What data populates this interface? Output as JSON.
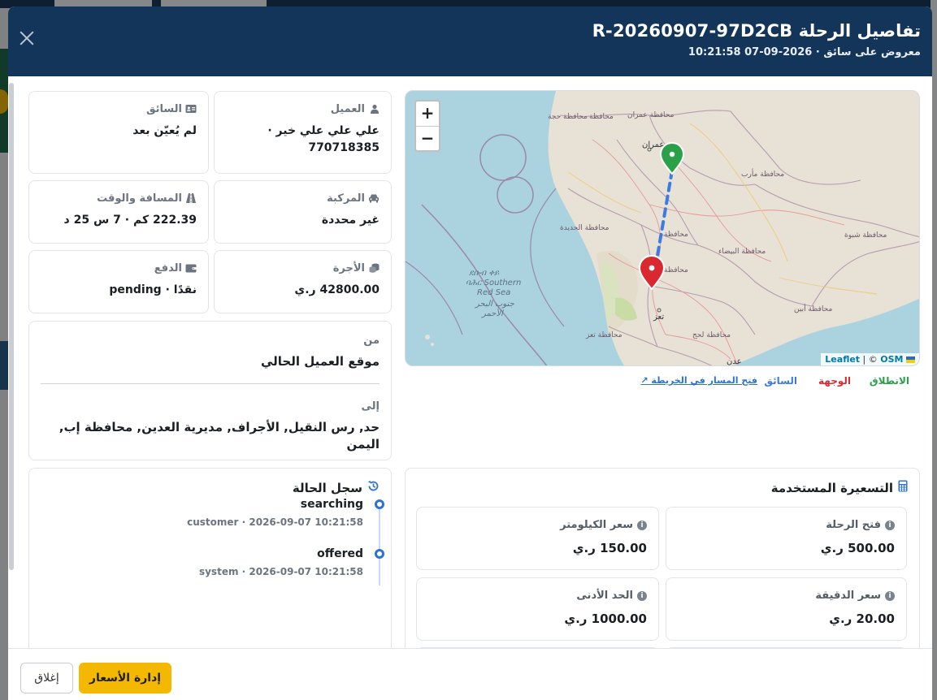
{
  "modal": {
    "title": "تفاصيل الرحلة R-20260907-97D2CB",
    "subtitle": "معروض على سائق · 2026-09-07 10:21:58"
  },
  "customer": {
    "label": "العميل",
    "value": "علي علي علي خير · 770718385",
    "icon": "user-icon"
  },
  "driver": {
    "label": "السائق",
    "value": "لم يُعيّن بعد",
    "icon": "id-card-icon"
  },
  "vehicle": {
    "label": "المركبة",
    "value": "غير محددة",
    "icon": "car-icon"
  },
  "distance": {
    "label": "المسافة والوقت",
    "value": "222.39 كم · 7 س 25 د",
    "icon": "road-icon"
  },
  "fare": {
    "label": "الأجرة",
    "value": "42800.00 ر.ي",
    "icon": "coins-icon"
  },
  "payment": {
    "label": "الدفع",
    "value": "نقدًا · pending",
    "icon": "wallet-icon"
  },
  "route": {
    "from_label": "من",
    "from_value": "موقع العميل الحالي",
    "to_label": "إلى",
    "to_value": "حد, رس النقيل, الأجراف, مديرية العدين, محافظة إب, اليمن"
  },
  "map": {
    "zoom_in": "+",
    "zoom_out": "−",
    "attribution_leaflet": "Leaflet",
    "attribution_sep": " | © ",
    "attribution_osm": "OSM",
    "labels": {
      "hajjah": "محافظة حجة",
      "amran_gov": "محافظة عمران",
      "amran": "عمران",
      "marib": "محافظة مأرب",
      "hudaydah": "محافظة الحديدة",
      "shabwah": "محافظة شبوة",
      "bayda": "محافظة البيضاء",
      "ibb": "محافظة",
      "taiz_city": "تعز",
      "taiz": "محافظة تعز",
      "lahj": "محافظة لحج",
      "abyan": "محافظة أبين",
      "aden": "عدن",
      "hajjah2": "محافظة",
      "sea_geez": "ደቡብ ቀይ",
      "sea_geez2": "ባሕር Southern",
      "sea_en": "Red Sea",
      "sea_ar": "جنوب البحر",
      "sea_ar2": "الأحمر"
    },
    "colors": {
      "start": "#2aa049",
      "destination": "#d9282f",
      "route": "#3d7be0"
    }
  },
  "legend": {
    "start": "الانطلاق",
    "destination": "الوجهة",
    "driver": "السائق",
    "open_route": "فتح المسار في الخريطة ↗"
  },
  "status_log": {
    "title": "سجل الحالة",
    "items": [
      {
        "status": "searching",
        "meta": "customer · 2026-09-07 10:21:58"
      },
      {
        "status": "offered",
        "meta": "system · 2026-09-07 10:21:58"
      }
    ]
  },
  "pricing": {
    "title": "التسعيرة المستخدمة",
    "items": [
      {
        "label": "فتح الرحلة",
        "value": "500.00 ر.ي"
      },
      {
        "label": "سعر الكيلومتر",
        "value": "150.00 ر.ي"
      },
      {
        "label": "سعر الدقيقة",
        "value": "20.00 ر.ي"
      },
      {
        "label": "الحد الأدنى",
        "value": "1000.00 ر.ي"
      }
    ]
  },
  "footer": {
    "manage_prices": "إدارة الأسعار",
    "close": "إغلاق"
  }
}
